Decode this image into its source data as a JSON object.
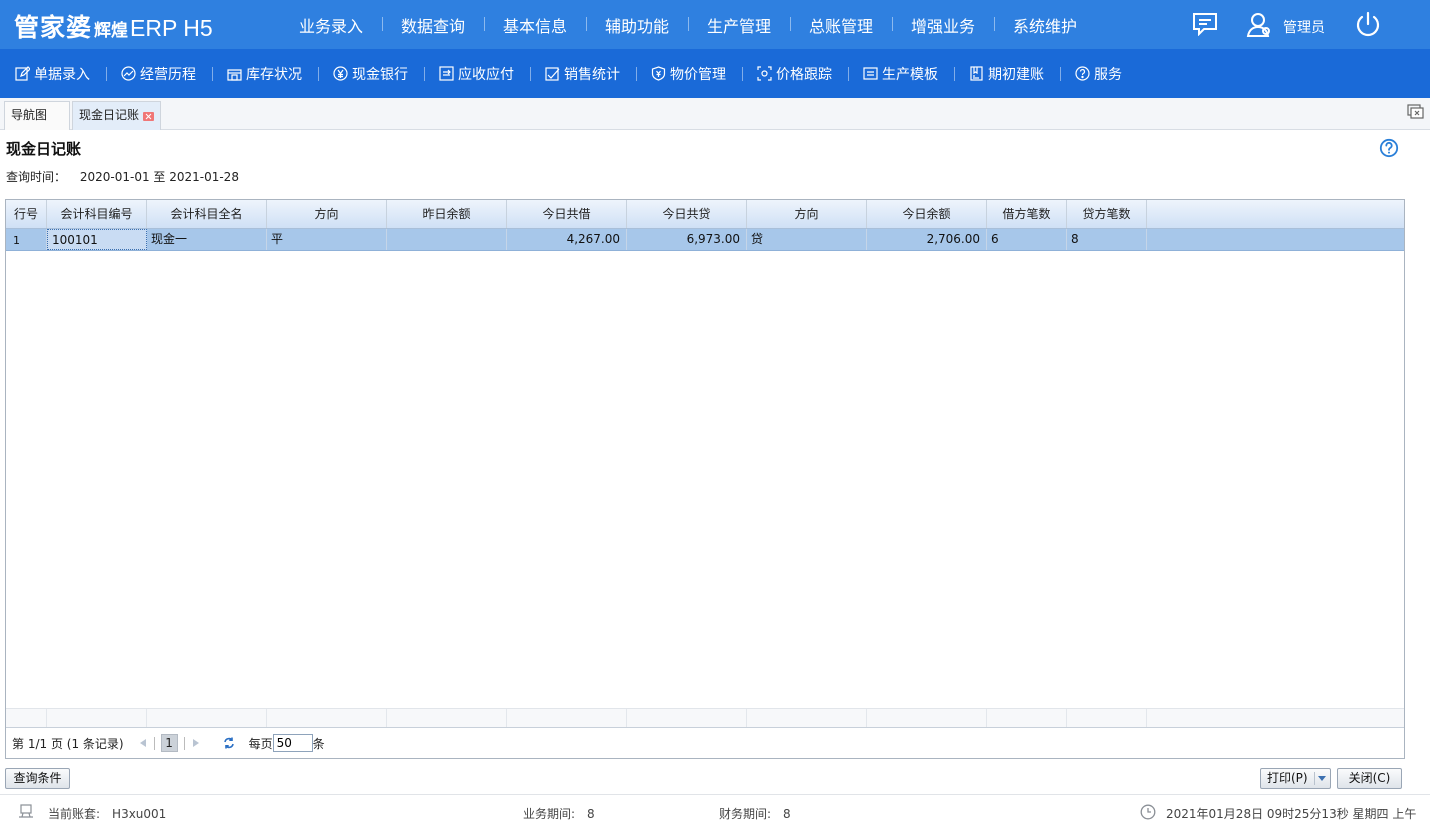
{
  "app": {
    "logo_main": "管家婆",
    "logo_sub": "辉煌",
    "logo_product": "ERP H5"
  },
  "main_nav": [
    "业务录入",
    "数据查询",
    "基本信息",
    "辅助功能",
    "生产管理",
    "总账管理",
    "增强业务",
    "系统维护"
  ],
  "user": {
    "name": "管理员"
  },
  "sub_nav": [
    {
      "label": "单据录入",
      "icon": "edit-icon"
    },
    {
      "label": "经营历程",
      "icon": "trend-icon"
    },
    {
      "label": "库存状况",
      "icon": "warehouse-icon"
    },
    {
      "label": "现金银行",
      "icon": "yen-icon"
    },
    {
      "label": "应收应付",
      "icon": "ledger-icon"
    },
    {
      "label": "销售统计",
      "icon": "sales-icon"
    },
    {
      "label": "物价管理",
      "icon": "shield-price-icon"
    },
    {
      "label": "价格跟踪",
      "icon": "track-icon"
    },
    {
      "label": "生产模板",
      "icon": "template-icon"
    },
    {
      "label": "期初建账",
      "icon": "book-icon"
    },
    {
      "label": "服务",
      "icon": "help-icon"
    }
  ],
  "tabs": [
    {
      "label": "导航图"
    },
    {
      "label": "现金日记账"
    }
  ],
  "page": {
    "title": "现金日记账",
    "query_label": "查询时间：",
    "query_value": "2020-01-01 至 2021-01-28"
  },
  "grid": {
    "columns": [
      "行号",
      "会计科目编号",
      "会计科目全名",
      "方向",
      "昨日余额",
      "今日共借",
      "今日共贷",
      "方向",
      "今日余额",
      "借方笔数",
      "贷方笔数"
    ],
    "rows": [
      [
        "1",
        "100101",
        "现金一",
        "平",
        "",
        "4,267.00",
        "6,973.00",
        "贷",
        "2,706.00",
        "6",
        "8"
      ]
    ]
  },
  "pager": {
    "info": "第 1/1 页 (1 条记录)",
    "current_page": "1",
    "per_page_label": "每页",
    "per_page_value": "50",
    "per_page_unit": "条"
  },
  "buttons": {
    "query": "查询条件",
    "print": "打印(P)",
    "close": "关闭(C)"
  },
  "status": {
    "account_label": "当前账套:",
    "account_value": "H3xu001",
    "business_period_label": "业务期间:",
    "business_period_value": "8",
    "finance_period_label": "财务期间:",
    "finance_period_value": "8",
    "datetime": "2021年01月28日 09时25分13秒 星期四 上午"
  },
  "colors": {
    "topbar": "#2f80e0",
    "subbar": "#1a6ad8",
    "selected_row": "#a7c7ea",
    "help_icon": "#2a7fd8"
  }
}
